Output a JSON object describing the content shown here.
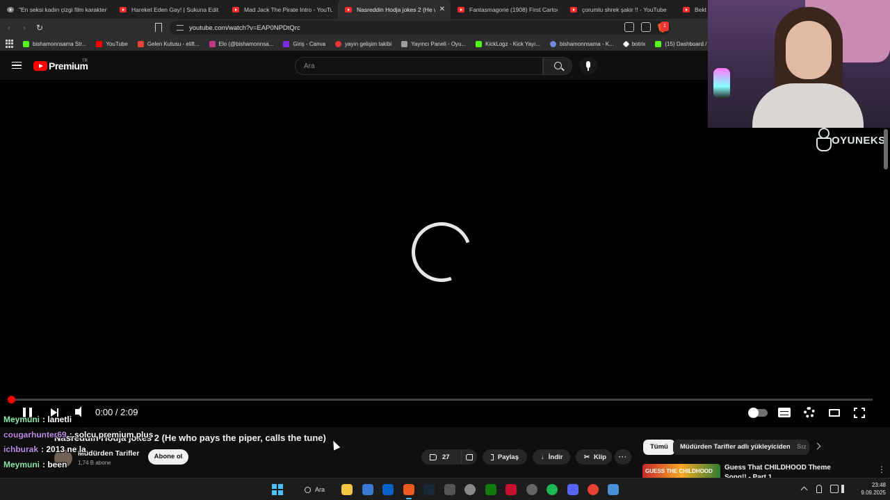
{
  "browser": {
    "tabs": [
      {
        "title": "\"En seksi kadın çizgi film karakterleri",
        "favicon": "generic",
        "active": false
      },
      {
        "title": "Hareket Eden Gay! | Sukuna Edit - Yo",
        "favicon": "youtube",
        "active": false
      },
      {
        "title": "Mad Jack The Pirate Intro - YouTube",
        "favicon": "youtube",
        "active": false
      },
      {
        "title": "Nasreddin Hodja jokes 2 (He wh",
        "favicon": "youtube",
        "active": true,
        "close": "✕"
      },
      {
        "title": "Fantasmagorie (1908) First Cartoon E",
        "favicon": "youtube",
        "active": false
      },
      {
        "title": "çorumlu shrek şakir !! - YouTube",
        "favicon": "youtube",
        "active": false
      },
      {
        "title": "Bekt",
        "favicon": "youtube",
        "active": false
      }
    ],
    "url": "youtube.com/watch?v=EAP0NPDtQrc",
    "brave_badge": "1",
    "bookmarks": [
      {
        "label": "bishamonnsama Str...",
        "color": "#53fc18"
      },
      {
        "label": "YouTube",
        "color": "#ff0000"
      },
      {
        "label": "Gelen Kutusu - elift...",
        "color": "#ea4335"
      },
      {
        "label": "Elo (@bishamonnsa...",
        "color": "#c13584"
      },
      {
        "label": "Giriş - Canva",
        "color": "#7d2ae8"
      },
      {
        "label": "yayın gelişim takibi",
        "color": "#e53935"
      },
      {
        "label": "Yayıncı Paneli - Oyu...",
        "color": "#9e9e9e"
      },
      {
        "label": "KickLogz - Kick Yayı...",
        "color": "#53fc18"
      },
      {
        "label": "bishamonnsama - K...",
        "color": "#7289da"
      },
      {
        "label": "botrix",
        "color": "#ffffff"
      },
      {
        "label": "(15) Dashboard / Str...",
        "color": "#53fc18"
      }
    ]
  },
  "youtube": {
    "logo_text": "Premium",
    "region": "TR",
    "search_placeholder": "Ara",
    "player": {
      "current_time": "0:00",
      "duration": "2:09",
      "time_display": "0:00 / 2:09",
      "progress_fraction": 0.0
    },
    "video": {
      "title": "Nasreddin Hodja jokes 2 (He who pays the piper, calls the tune)",
      "channel": "Müdürden Tarifler",
      "subscribers": "1,74 B abone",
      "subscribe_label": "Abone ol",
      "likes": "27",
      "share_label": "Paylaş",
      "download_label": "İndir",
      "clip_label": "Klip",
      "more_label": "···"
    },
    "chips": [
      {
        "label": "Tümü",
        "selected": true
      },
      {
        "label": "Müdürden Tarifler adlı yükleyiciden",
        "selected": false
      },
      {
        "label": "Sız",
        "selected": false
      }
    ],
    "recommendation": {
      "title_line1": "Guess That CHILDHOOD Theme",
      "title_line2": "Song!! - Part 1",
      "thumbnail_text": "GUESS THE CHILDHOOD"
    }
  },
  "chat": [
    {
      "user": "Meymuni",
      "color": "#8be9a8",
      "text": ": lanetli"
    },
    {
      "user": "cougarhunter69",
      "color": "#c08be9",
      "text": ": solcu premium plus"
    },
    {
      "user": "ichburak",
      "color": "#c08be9",
      "text": ": 2013 ne la"
    },
    {
      "user": "Meymuni",
      "color": "#8be9a8",
      "text": ": been"
    }
  ],
  "stream_overlay": {
    "brand": "OYUNEKS"
  },
  "taskbar": {
    "search_label": "Ara",
    "time": "23:48",
    "date": "9.09.2025"
  }
}
